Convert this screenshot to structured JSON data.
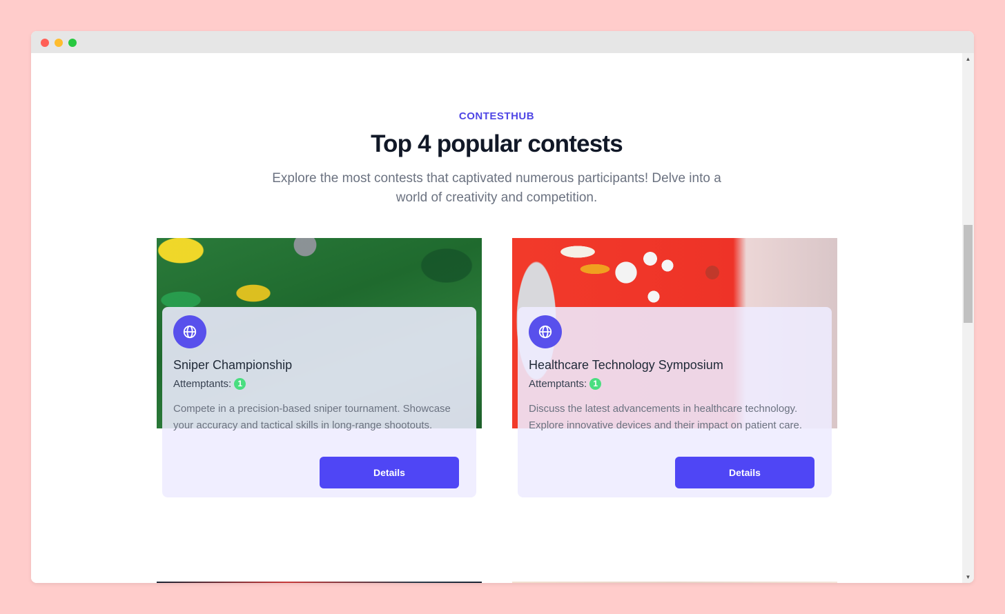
{
  "browser": {
    "controls": [
      "close",
      "minimize",
      "maximize"
    ]
  },
  "section": {
    "eyebrow": "CONTESTHUB",
    "heading": "Top 4 popular contests",
    "subtitle": "Explore the most contests that captivated numerous participants! Delve into a world of creativity and competition."
  },
  "contests": [
    {
      "icon": "globe-icon",
      "title": "Sniper Championship",
      "attempt_label": "Attemptants:",
      "attempt_count": "1",
      "description": "Compete in a precision-based sniper tournament. Showcase your accuracy and tactical skills in long-range shootouts.",
      "button_label": "Details"
    },
    {
      "icon": "globe-icon",
      "title": "Healthcare Technology Symposium",
      "attempt_label": "Attemptants:",
      "attempt_count": "1",
      "description": "Discuss the latest advancements in healthcare technology. Explore innovative devices and their impact on patient care.",
      "button_label": "Details"
    }
  ],
  "colors": {
    "page_background": "#ffcccb",
    "accent": "#4f46f5",
    "badge": "#4ade80",
    "card_background": "#eeecff"
  }
}
